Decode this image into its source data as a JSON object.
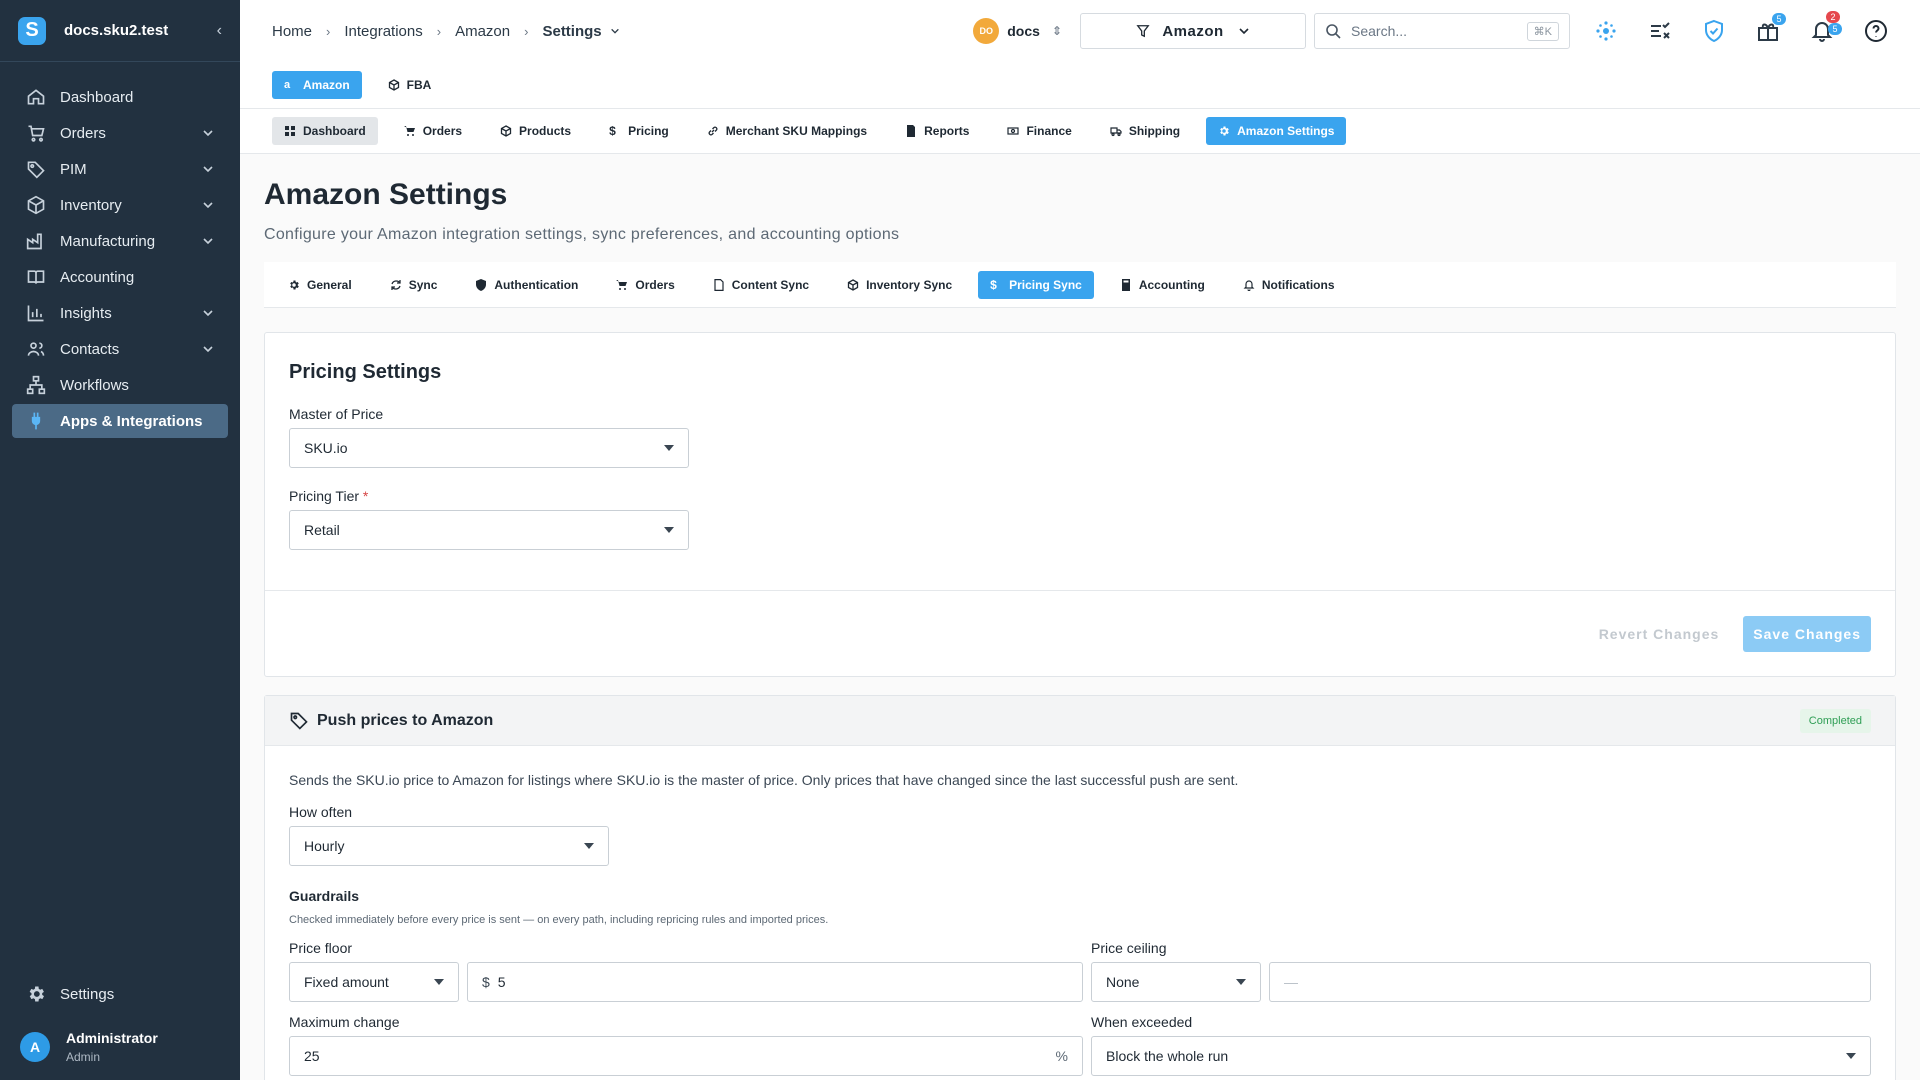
{
  "sidebar": {
    "site": "docs.sku2.test",
    "logo_letter": "S",
    "items": [
      {
        "label": "Dashboard",
        "icon": "home-icon",
        "expand": false
      },
      {
        "label": "Orders",
        "icon": "cart-icon",
        "expand": true
      },
      {
        "label": "PIM",
        "icon": "tag-icon",
        "expand": true
      },
      {
        "label": "Inventory",
        "icon": "box-icon",
        "expand": true
      },
      {
        "label": "Manufacturing",
        "icon": "factory-icon",
        "expand": true
      },
      {
        "label": "Accounting",
        "icon": "book-icon",
        "expand": false
      },
      {
        "label": "Insights",
        "icon": "bar-chart-icon",
        "expand": true
      },
      {
        "label": "Contacts",
        "icon": "users-icon",
        "expand": true
      },
      {
        "label": "Workflows",
        "icon": "workflow-icon",
        "expand": false
      },
      {
        "label": "Apps & Integrations",
        "icon": "plug-icon",
        "expand": false,
        "active": true
      }
    ],
    "settings_label": "Settings",
    "user": {
      "initial": "A",
      "name": "Administrator",
      "role": "Admin"
    }
  },
  "topbar": {
    "breadcrumbs": [
      "Home",
      "Integrations",
      "Amazon",
      "Settings"
    ],
    "org": {
      "initials": "DO",
      "name": "docs"
    },
    "channel": "Amazon",
    "search": {
      "placeholder": "Search...",
      "shortcut": "⌘K"
    },
    "badges": {
      "gift": "5",
      "notif_red": "2",
      "notif_blue": "5"
    }
  },
  "subtabs": [
    "Amazon",
    "FBA"
  ],
  "nav_tabs": [
    "Dashboard",
    "Orders",
    "Products",
    "Pricing",
    "Merchant SKU Mappings",
    "Reports",
    "Finance",
    "Shipping",
    "Amazon Settings"
  ],
  "page": {
    "title": "Amazon Settings",
    "subtitle": "Configure your Amazon integration settings, sync preferences, and accounting options"
  },
  "settings_tabs": [
    "General",
    "Sync",
    "Authentication",
    "Orders",
    "Content Sync",
    "Inventory Sync",
    "Pricing Sync",
    "Accounting",
    "Notifications"
  ],
  "pricing_settings": {
    "title": "Pricing Settings",
    "master_label": "Master of Price",
    "master_value": "SKU.io",
    "tier_label": "Pricing Tier",
    "tier_required": "*",
    "tier_value": "Retail",
    "revert_label": "Revert Changes",
    "save_label": "Save Changes"
  },
  "push_prices": {
    "title": "Push prices to Amazon",
    "status": "Completed",
    "description": "Sends the SKU.io price to Amazon for listings where SKU.io is the master of price. Only prices that have changed since the last successful push are sent.",
    "how_often_label": "How often",
    "how_often_value": "Hourly",
    "guardrails_title": "Guardrails",
    "guardrails_hint": "Checked immediately before every price is sent — on every path, including repricing rules and imported prices.",
    "floor_label": "Price floor",
    "floor_type": "Fixed amount",
    "floor_currency": "$",
    "floor_value": "5",
    "ceiling_label": "Price ceiling",
    "ceiling_type": "None",
    "ceiling_value": "—",
    "max_change_label": "Maximum change",
    "max_change_value": "25",
    "max_change_unit": "%",
    "exceeded_label": "When exceeded",
    "exceeded_value": "Block the whole run"
  },
  "colors": {
    "sidebar": "#223140",
    "accent": "#3aa4ee",
    "success": "#2f9e55"
  }
}
